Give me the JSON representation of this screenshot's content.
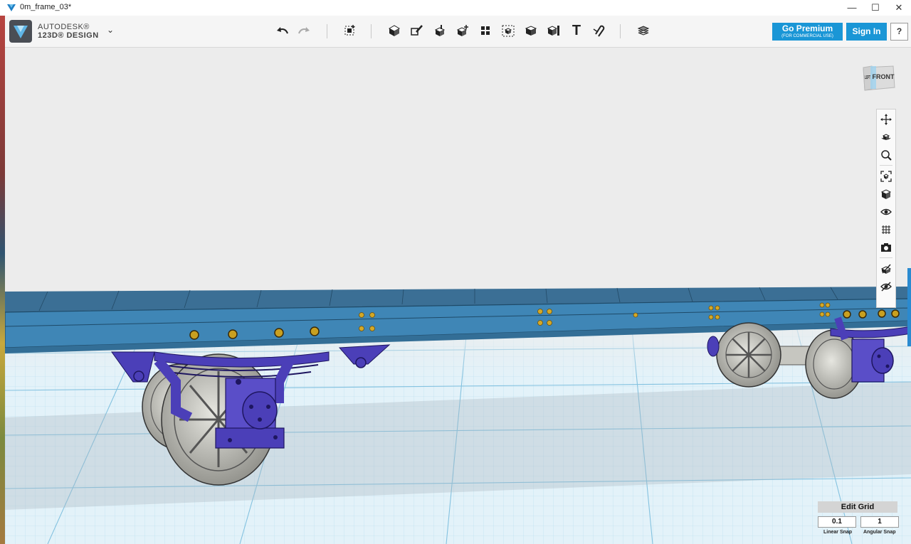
{
  "window": {
    "title": "0m_frame_03*",
    "minimize_glyph": "—",
    "maximize_glyph": "☐",
    "close_glyph": "✕"
  },
  "app": {
    "brand_line1": "AUTODESK®",
    "brand_line2": "123D® DESIGN",
    "menu_chevron": "⌄"
  },
  "toolbar": {
    "icons": [
      "undo-icon",
      "redo-icon",
      "transform-icon",
      "primitives-icon",
      "sketch-icon",
      "construct-icon",
      "modify-icon",
      "pattern-icon",
      "group-icon",
      "combine-icon",
      "measure-icon",
      "text-icon",
      "snap-icon",
      "material-icon"
    ],
    "text_tool_glyph": "T"
  },
  "account": {
    "premium_label": "Go Premium",
    "premium_sub": "(FOR COMMERCIAL USE)",
    "signin_label": "Sign In",
    "help_label": "?"
  },
  "viewcube": {
    "front_label": "FRONT",
    "left_label": "LEFT"
  },
  "nav_tools": [
    "pan-icon",
    "orbit-icon",
    "zoom-icon",
    "fit-icon",
    "view-cube-icon",
    "visibility-icon",
    "grid-material-icon",
    "snapshot-icon",
    "physical-material-icon",
    "hide-icon"
  ],
  "edit_grid": {
    "title": "Edit Grid",
    "linear_snap_value": "0.1",
    "angular_snap_value": "1",
    "linear_snap_label": "Linear Snap",
    "angular_snap_label": "Angular Snap"
  },
  "colors": {
    "accent": "#1a96d6",
    "chassis": "#3f86b6",
    "suspension": "#4b3fb8",
    "wheel": "#bdbdb6",
    "grid_line": "#84c2e0"
  }
}
